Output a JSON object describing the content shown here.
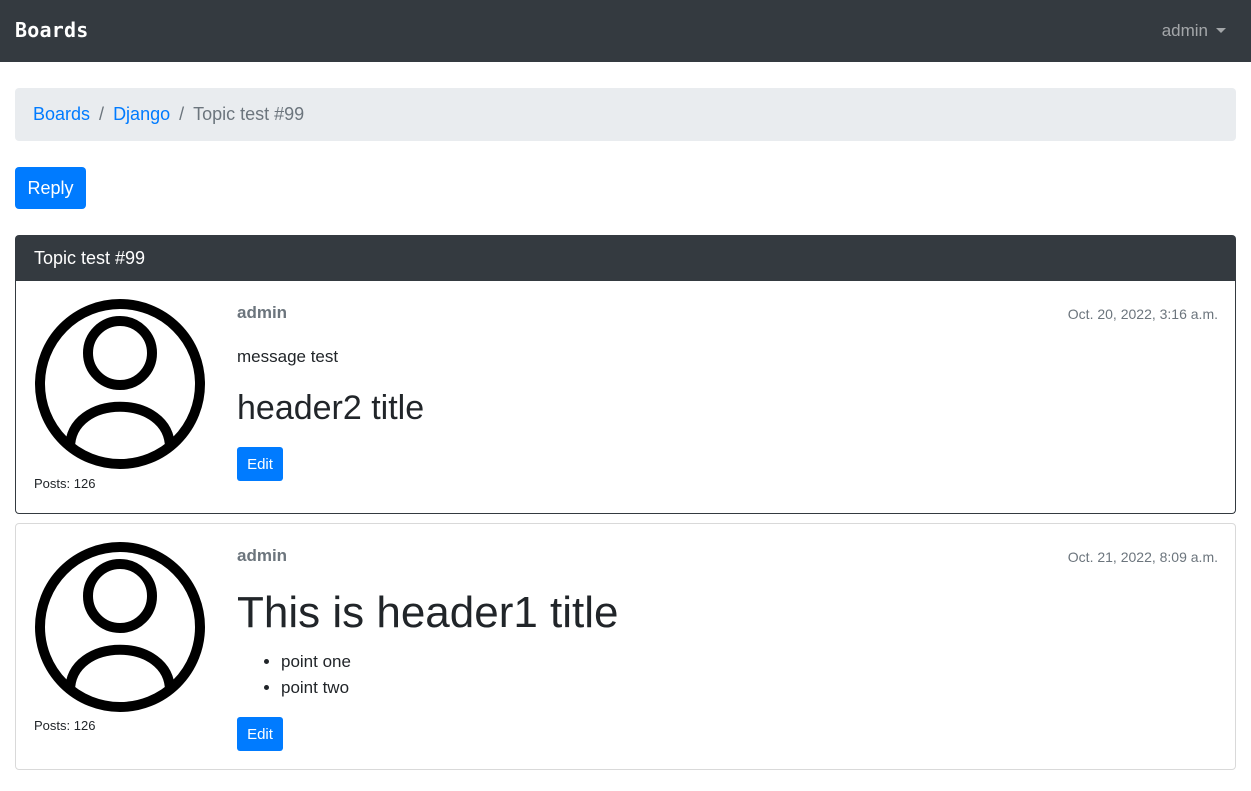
{
  "navbar": {
    "brand": "Boards",
    "user": "admin"
  },
  "breadcrumb": {
    "items": [
      "Boards",
      "Django"
    ],
    "active": "Topic test #99"
  },
  "reply_button": "Reply",
  "topic": {
    "title": "Topic test #99"
  },
  "posts": [
    {
      "author": "admin",
      "date": "Oct. 20, 2022, 3:16 a.m.",
      "message": "message test",
      "heading": "header2 title",
      "posts_count": "Posts: 126",
      "edit_label": "Edit"
    },
    {
      "author": "admin",
      "date": "Oct. 21, 2022, 8:09 a.m.",
      "heading": "This is header1 title",
      "list_items": [
        "point one",
        "point two"
      ],
      "posts_count": "Posts: 126",
      "edit_label": "Edit"
    }
  ],
  "colors": {
    "navbar_bg": "#343a40",
    "primary": "#007bff",
    "breadcrumb_bg": "#e9ecef",
    "muted": "#6c757d"
  }
}
